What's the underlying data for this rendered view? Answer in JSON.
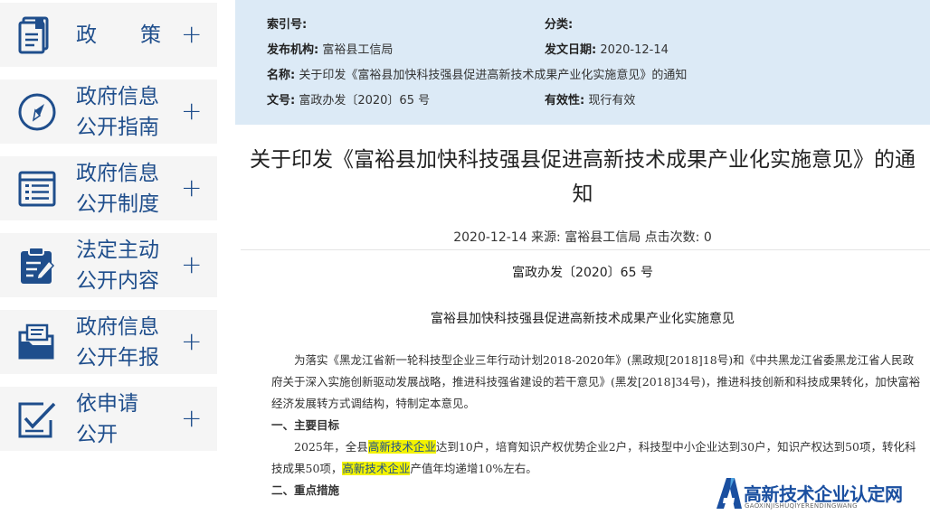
{
  "sidebar": {
    "items": [
      {
        "icon": "document-icon",
        "label_lines": [
          "政",
          "策"
        ]
      },
      {
        "icon": "compass-icon",
        "label_lines": [
          "政府信息",
          "公开指南"
        ]
      },
      {
        "icon": "list-icon",
        "label_lines": [
          "政府信息",
          "公开制度"
        ]
      },
      {
        "icon": "clipboard-edit-icon",
        "label_lines": [
          "法定主动",
          "公开内容"
        ]
      },
      {
        "icon": "folder-icon",
        "label_lines": [
          "政府信息",
          "公开年报"
        ]
      },
      {
        "icon": "check-edit-icon",
        "label_lines": [
          "依申请",
          "公开"
        ]
      }
    ],
    "expand_symbol": "+"
  },
  "meta": {
    "index_label": "索引号:",
    "index_value": "",
    "category_label": "分类:",
    "category_value": "",
    "publisher_label": "发布机构:",
    "publisher_value": "富裕县工信局",
    "date_label": "发文日期:",
    "date_value": "2020-12-14",
    "name_label": "名称:",
    "name_value": "关于印发《富裕县加快科技强县促进高新技术成果产业化实施意见》的通知",
    "docno_label": "文号:",
    "docno_value": "富政办发〔2020〕65 号",
    "validity_label": "有效性:",
    "validity_value": "现行有效"
  },
  "article": {
    "title_line1": "关于印发《富裕县加快科技强县促进高新技术成果产业化实施意见》的通",
    "title_line2": "知",
    "info": "2020-12-14   来源: 富裕县工信局 点击次数: 0",
    "doc_number": "富政办发〔2020〕65 号",
    "subtitle": "富裕县加快科技强县促进高新技术成果产业化实施意见",
    "para1": "为落实《黑龙江省新一轮科技型企业三年行动计划2018-2020年》(黑政规[2018]18号)和《中共黑龙江省委黑龙江省人民政府关于深入实施创新驱动发展战略，推进科技强省建设的若干意见》(黑发[2018]34号)，推进科技创新和科技成果转化，加快富裕经济发展转方式调结构，特制定本意见。",
    "heading1": "一、主要目标",
    "para2_a": "2025年，全县",
    "para2_hl1": "高新技术企业",
    "para2_b": "达到10户，培育知识产权优势企业2户，科技型中小企业达到30户，知识产权达到50项，转化科技成果50项，",
    "para2_hl2": "高新技术企业",
    "para2_c": "产值年均递增10%左右。",
    "heading2": "二、重点措施"
  },
  "watermark": {
    "title": "高新技术企业认定网",
    "subtitle": "GAOXINJISHUQIYERENDINGWANG"
  },
  "colors": {
    "nav_text": "#1f4e8c",
    "meta_bg": "#dceaf6",
    "highlight": "#f2f200",
    "watermark": "#1a4fa0"
  }
}
